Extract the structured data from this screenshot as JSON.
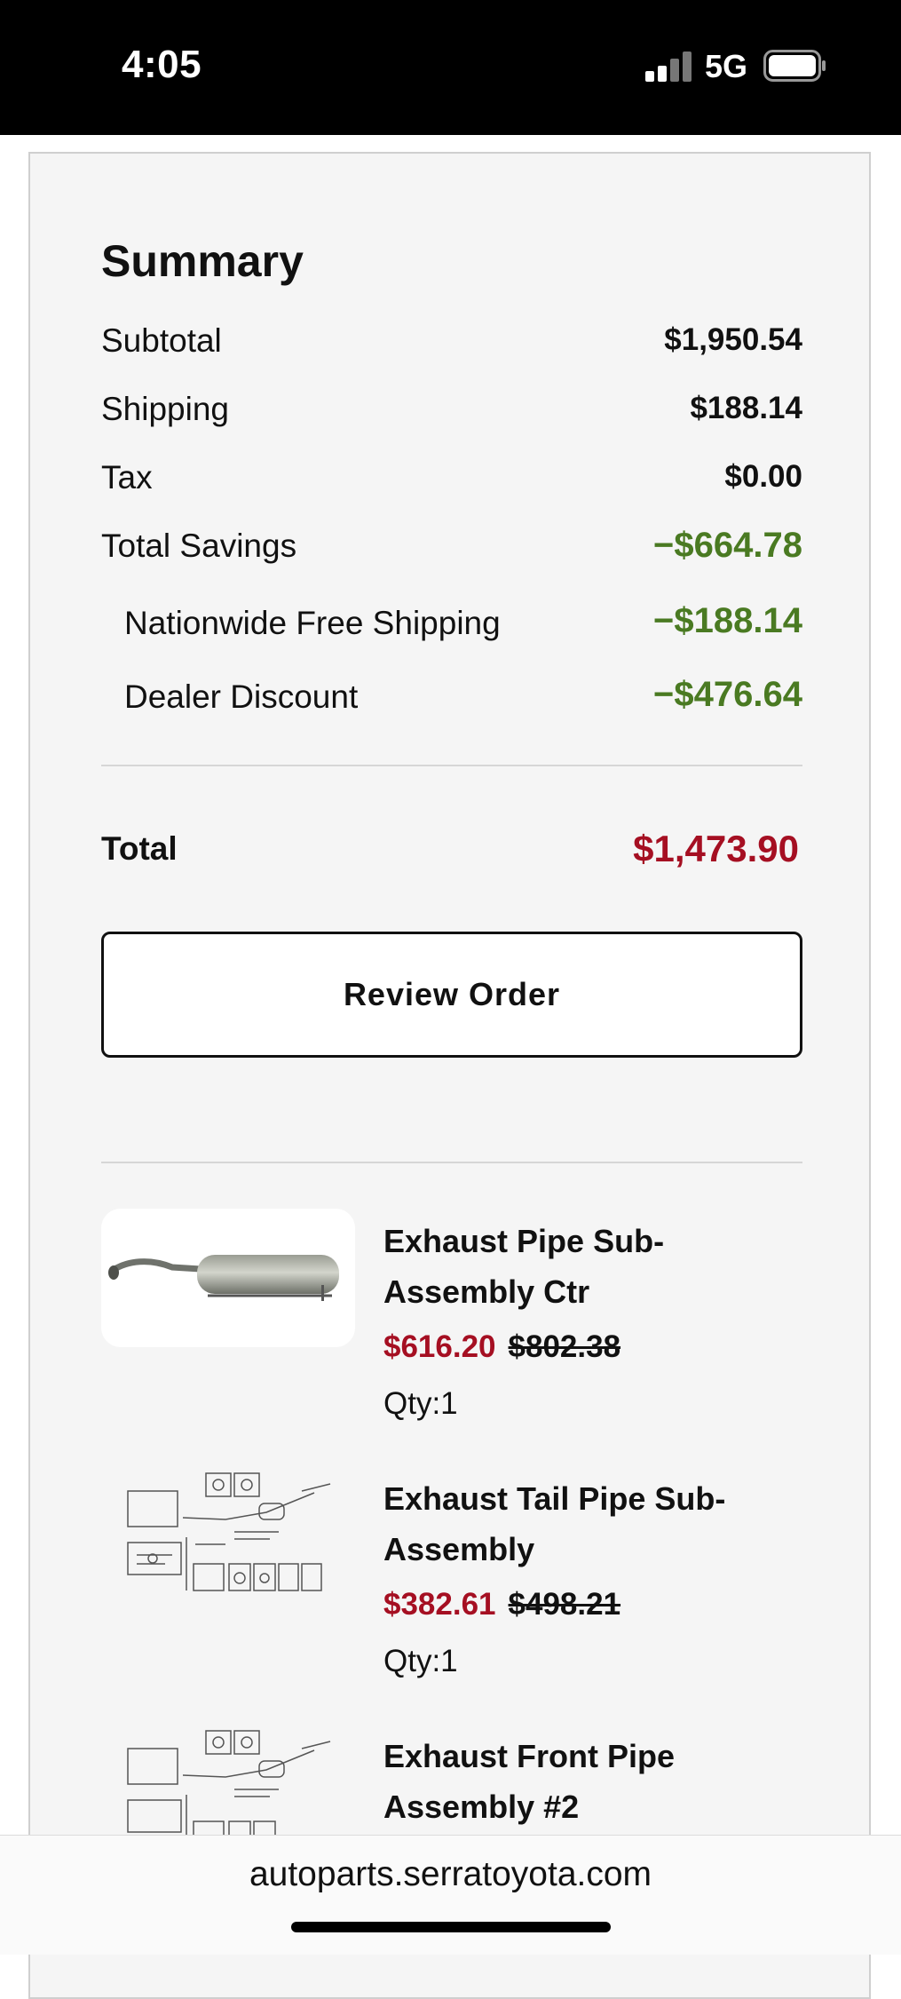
{
  "status_bar": {
    "time": "4:05",
    "network": "5G",
    "icons": [
      "signal-icon",
      "battery-icon"
    ]
  },
  "summary": {
    "title": "Summary",
    "subtotal_label": "Subtotal",
    "subtotal_value": "$1,950.54",
    "shipping_label": "Shipping",
    "shipping_value": "$188.14",
    "tax_label": "Tax",
    "tax_value": "$0.00",
    "savings_label": "Total Savings",
    "savings_value": "−$664.78",
    "savings_items": [
      {
        "label": "Nationwide Free Shipping",
        "value": "−$188.14"
      },
      {
        "label": "Dealer Discount",
        "value": "−$476.64"
      }
    ],
    "total_label": "Total",
    "total_value": "$1,473.90",
    "review_button": "Review Order"
  },
  "items": [
    {
      "name": "Exhaust Pipe Sub-Assembly Ctr",
      "sale_price": "$616.20",
      "orig_price": "$802.38",
      "qty": "Qty:1",
      "image": "muffler-photo"
    },
    {
      "name": "Exhaust Tail Pipe Sub-Assembly",
      "sale_price": "$382.61",
      "orig_price": "$498.21",
      "qty": "Qty:1",
      "image": "parts-diagram"
    },
    {
      "name": "Exhaust Front Pipe Assembly #2",
      "image": "parts-diagram"
    }
  ],
  "browser": {
    "url": "autoparts.serratoyota.com"
  },
  "colors": {
    "sale_red": "#a50f22",
    "savings_green": "#4a7a22",
    "card_bg": "#f5f5f5"
  }
}
